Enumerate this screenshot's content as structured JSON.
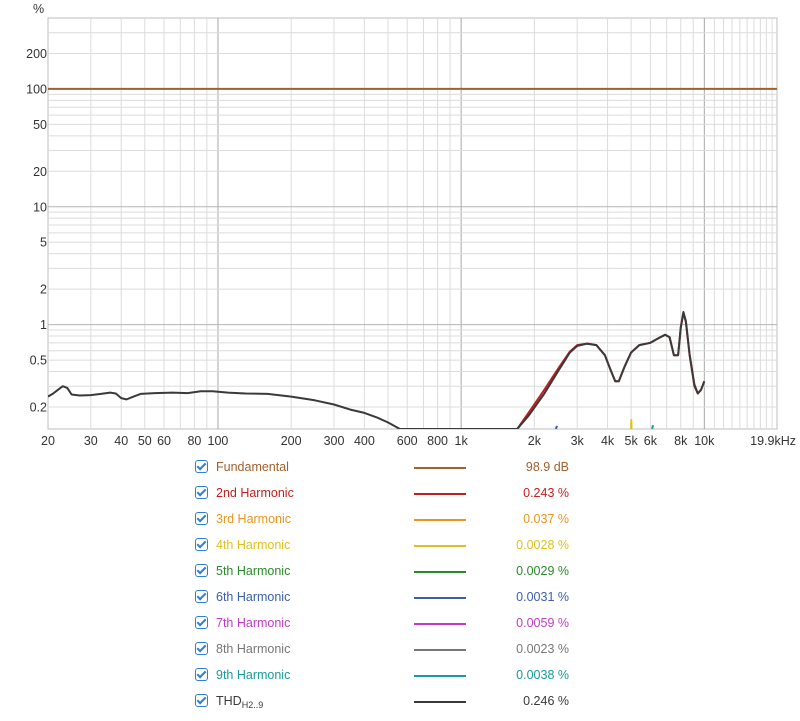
{
  "chart_data": {
    "type": "line",
    "ylabel": "%",
    "x_scale": "log",
    "y_scale": "log",
    "xlim": [
      20,
      19900
    ],
    "ylim": [
      0.13,
      400
    ],
    "x_ticks": [
      {
        "v": 20,
        "label": "20"
      },
      {
        "v": 30,
        "label": "30"
      },
      {
        "v": 40,
        "label": "40"
      },
      {
        "v": 50,
        "label": "50"
      },
      {
        "v": 60,
        "label": "60"
      },
      {
        "v": 80,
        "label": "80"
      },
      {
        "v": 100,
        "label": "100"
      },
      {
        "v": 200,
        "label": "200"
      },
      {
        "v": 300,
        "label": "300"
      },
      {
        "v": 400,
        "label": "400"
      },
      {
        "v": 600,
        "label": "600"
      },
      {
        "v": 800,
        "label": "800"
      },
      {
        "v": 1000,
        "label": "1k"
      },
      {
        "v": 2000,
        "label": "2k"
      },
      {
        "v": 3000,
        "label": "3k"
      },
      {
        "v": 4000,
        "label": "4k"
      },
      {
        "v": 5000,
        "label": "5k"
      },
      {
        "v": 6000,
        "label": "6k"
      },
      {
        "v": 8000,
        "label": "8k"
      },
      {
        "v": 10000,
        "label": "10k"
      },
      {
        "v": 19900,
        "label": "19.9kHz"
      }
    ],
    "y_ticks": [
      {
        "v": 200,
        "label": "200"
      },
      {
        "v": 100,
        "label": "100"
      },
      {
        "v": 50,
        "label": "50"
      },
      {
        "v": 20,
        "label": "20"
      },
      {
        "v": 10,
        "label": "10"
      },
      {
        "v": 5,
        "label": "5"
      },
      {
        "v": 2,
        "label": "2"
      },
      {
        "v": 1,
        "label": "1"
      },
      {
        "v": 0.5,
        "label": "0.5"
      },
      {
        "v": 0.2,
        "label": "0.2"
      }
    ],
    "grid": true,
    "series": [
      {
        "name": "Fundamental",
        "value": "98.9 dB",
        "color": "#a0612d",
        "points": [
          [
            20,
            100
          ],
          [
            19900,
            100
          ]
        ]
      },
      {
        "name": "2nd Harmonic",
        "value": "0.243 %",
        "color": "#c11f1f",
        "points": [
          [
            1700,
            0.13
          ],
          [
            1900,
            0.18
          ],
          [
            2200,
            0.28
          ],
          [
            2500,
            0.42
          ],
          [
            2800,
            0.59
          ],
          [
            3000,
            0.67
          ],
          [
            3300,
            0.69
          ],
          [
            3600,
            0.67
          ],
          [
            3900,
            0.55
          ],
          [
            4100,
            0.42
          ],
          [
            4300,
            0.33
          ],
          [
            4450,
            0.33
          ],
          [
            4700,
            0.44
          ],
          [
            5000,
            0.58
          ],
          [
            5400,
            0.67
          ],
          [
            6000,
            0.7
          ],
          [
            6500,
            0.77
          ],
          [
            6900,
            0.82
          ],
          [
            7200,
            0.78
          ],
          [
            7500,
            0.55
          ],
          [
            7800,
            0.55
          ],
          [
            8000,
            0.95
          ],
          [
            8200,
            1.25
          ],
          [
            8400,
            1.05
          ],
          [
            8700,
            0.55
          ],
          [
            9100,
            0.3
          ],
          [
            9400,
            0.26
          ],
          [
            9700,
            0.28
          ],
          [
            10000,
            0.33
          ]
        ]
      },
      {
        "name": "3rd Harmonic",
        "value": "0.037 %",
        "color": "#e8961f",
        "points": []
      },
      {
        "name": "4th Harmonic",
        "value": "0.0028 %",
        "color": "#e0c020",
        "points": [
          [
            5000,
            0.13
          ],
          [
            5010,
            0.155
          ],
          [
            5020,
            0.13
          ]
        ]
      },
      {
        "name": "5th Harmonic",
        "value": "0.0029 %",
        "color": "#2a8a2a",
        "points": []
      },
      {
        "name": "6th Harmonic",
        "value": "0.0031 %",
        "color": "#3a5fa8",
        "points": [
          [
            2450,
            0.13
          ],
          [
            2480,
            0.138
          ]
        ]
      },
      {
        "name": "7th Harmonic",
        "value": "0.0059 %",
        "color": "#c03cc8",
        "points": []
      },
      {
        "name": "8th Harmonic",
        "value": "0.0023 %",
        "color": "#777777",
        "points": []
      },
      {
        "name": "9th Harmonic",
        "value": "0.0038 %",
        "color": "#1a9a9a",
        "points": [
          [
            6100,
            0.13
          ],
          [
            6150,
            0.14
          ]
        ]
      },
      {
        "name": "THD",
        "name_sub": "H2..9",
        "value": "0.246 %",
        "color": "#3a3a3a",
        "points": [
          [
            20,
            0.245
          ],
          [
            21,
            0.26
          ],
          [
            22,
            0.28
          ],
          [
            23,
            0.3
          ],
          [
            24,
            0.29
          ],
          [
            25,
            0.255
          ],
          [
            27,
            0.25
          ],
          [
            30,
            0.252
          ],
          [
            33,
            0.258
          ],
          [
            36,
            0.265
          ],
          [
            38,
            0.26
          ],
          [
            40,
            0.238
          ],
          [
            42,
            0.232
          ],
          [
            45,
            0.245
          ],
          [
            48,
            0.258
          ],
          [
            55,
            0.262
          ],
          [
            65,
            0.265
          ],
          [
            75,
            0.262
          ],
          [
            85,
            0.272
          ],
          [
            95,
            0.272
          ],
          [
            110,
            0.265
          ],
          [
            130,
            0.26
          ],
          [
            160,
            0.258
          ],
          [
            200,
            0.245
          ],
          [
            250,
            0.228
          ],
          [
            300,
            0.21
          ],
          [
            350,
            0.19
          ],
          [
            400,
            0.178
          ],
          [
            450,
            0.163
          ],
          [
            500,
            0.148
          ],
          [
            560,
            0.13
          ],
          [
            1700,
            0.13
          ],
          [
            1900,
            0.17
          ],
          [
            2200,
            0.26
          ],
          [
            2500,
            0.4
          ],
          [
            2800,
            0.58
          ],
          [
            3000,
            0.66
          ],
          [
            3300,
            0.69
          ],
          [
            3600,
            0.67
          ],
          [
            3900,
            0.55
          ],
          [
            4100,
            0.42
          ],
          [
            4300,
            0.33
          ],
          [
            4450,
            0.33
          ],
          [
            4700,
            0.44
          ],
          [
            5000,
            0.58
          ],
          [
            5400,
            0.67
          ],
          [
            6000,
            0.7
          ],
          [
            6500,
            0.77
          ],
          [
            6900,
            0.82
          ],
          [
            7200,
            0.78
          ],
          [
            7500,
            0.55
          ],
          [
            7800,
            0.55
          ],
          [
            8000,
            0.95
          ],
          [
            8200,
            1.28
          ],
          [
            8400,
            1.07
          ],
          [
            8700,
            0.56
          ],
          [
            9100,
            0.31
          ],
          [
            9400,
            0.26
          ],
          [
            9700,
            0.28
          ],
          [
            10000,
            0.33
          ]
        ]
      }
    ]
  }
}
